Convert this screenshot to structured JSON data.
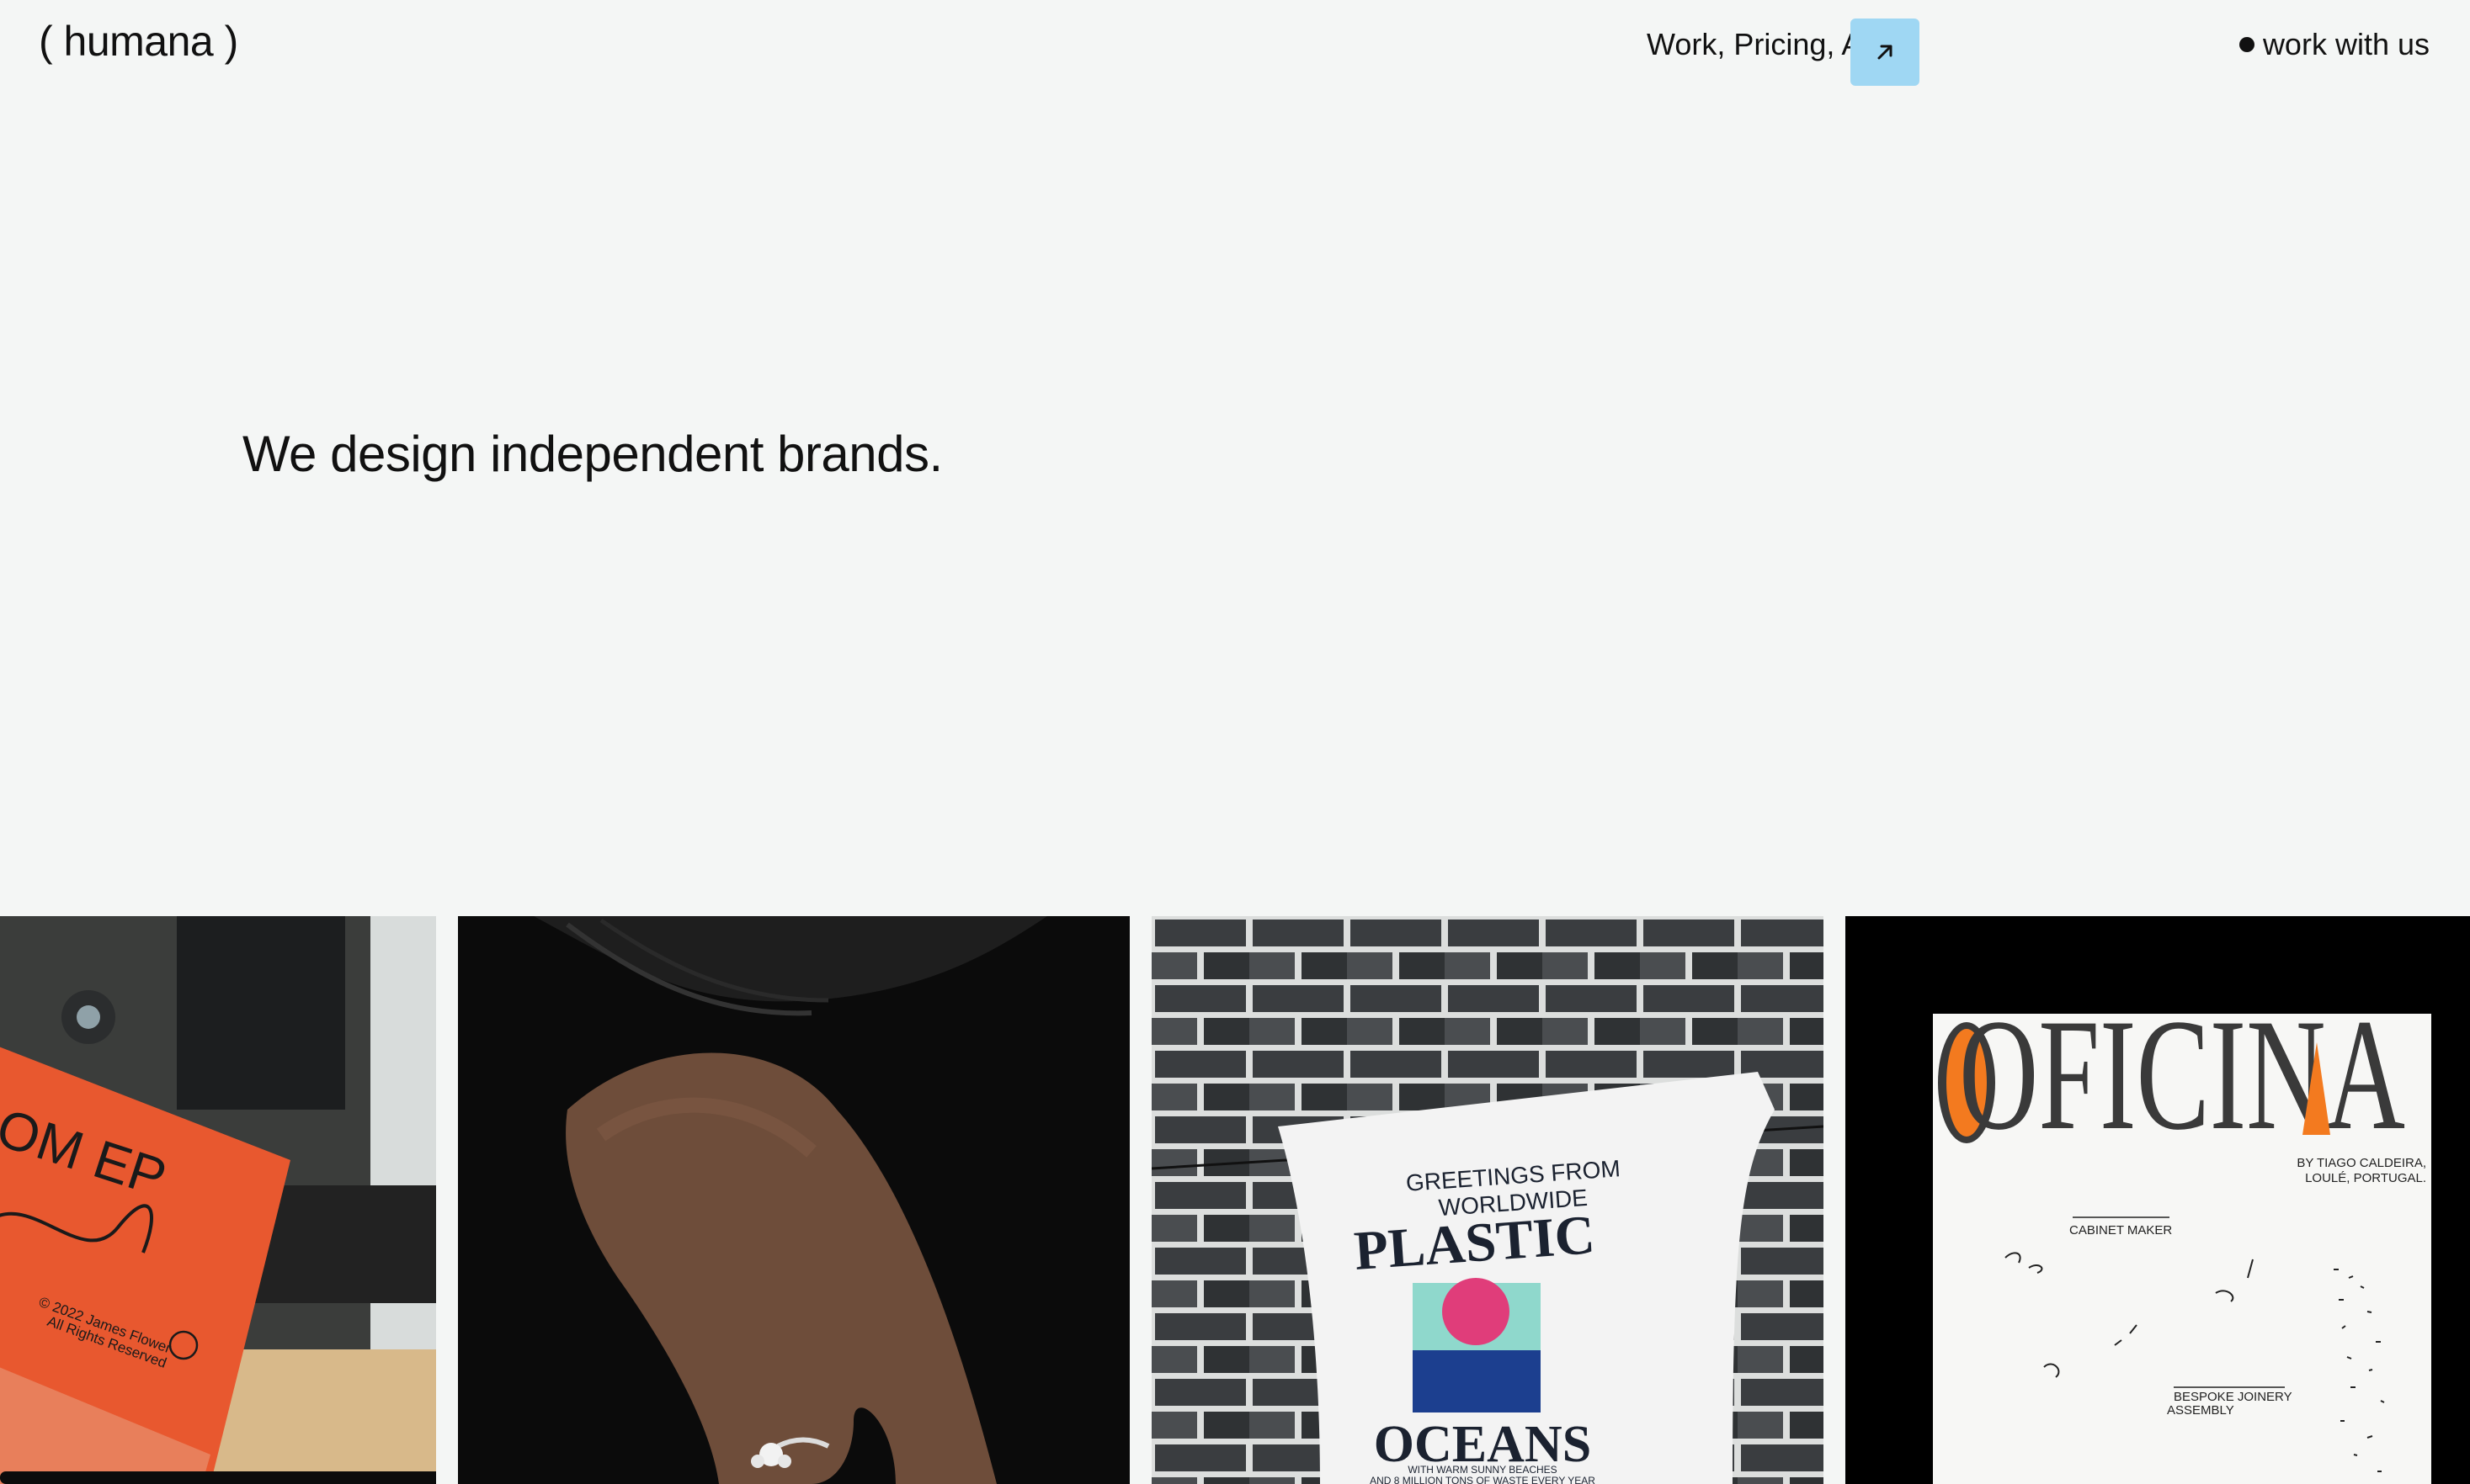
{
  "header": {
    "logo": "( humana )",
    "nav_text": "Work, Pricing, A",
    "cta_label": "work with us"
  },
  "hero": {
    "headline": "We design independent brands."
  },
  "cards": {
    "record": {
      "sleeve_title": "OM EP",
      "copyright_line1": "© 2022 James Flower",
      "copyright_line2": "All Rights Reserved"
    },
    "tshirt": {
      "line1": "GREETINGS FROM",
      "line2": "WORLDWIDE",
      "line3": "PLASTIC",
      "line4": "OCEANS",
      "line5": "WITH WARM SUNNY BEACHES",
      "line6": "AND 8 MILLION TONS OF WASTE EVERY YEAR"
    },
    "poster": {
      "title": "OFICINA",
      "byline1": "BY TIAGO CALDEIRA,",
      "byline2": "LOULÉ, PORTUGAL.",
      "label1": "CABINET MAKER",
      "label2a": "BESPOKE JOINERY",
      "label2b": "ASSEMBLY"
    }
  },
  "colors": {
    "background": "#f4f6f5",
    "nav_arrow_bg": "#9fd7f3",
    "record_orange": "#e8582f",
    "poster_orange": "#f37a1f"
  },
  "icons": {
    "nav_arrow": "arrow-up-right-icon",
    "cta_dot": "dot-icon"
  }
}
